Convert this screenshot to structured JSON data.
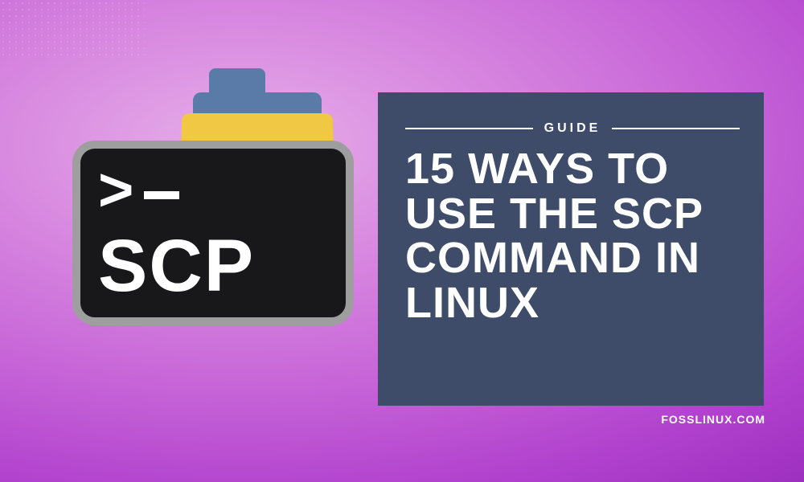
{
  "terminal": {
    "prompt_char": ">",
    "label": "SCP"
  },
  "panel": {
    "eyebrow": "GUIDE",
    "headline": "15 WAYS TO USE THE SCP COMMAND IN LINUX"
  },
  "footer": {
    "site": "FOSSLINUX.COM"
  },
  "colors": {
    "panel_bg": "#3e4c69",
    "folder_front": "#f0c843",
    "folder_back": "#5a7ba8",
    "terminal_bg": "#18181a",
    "terminal_border": "#9e9e9e"
  }
}
